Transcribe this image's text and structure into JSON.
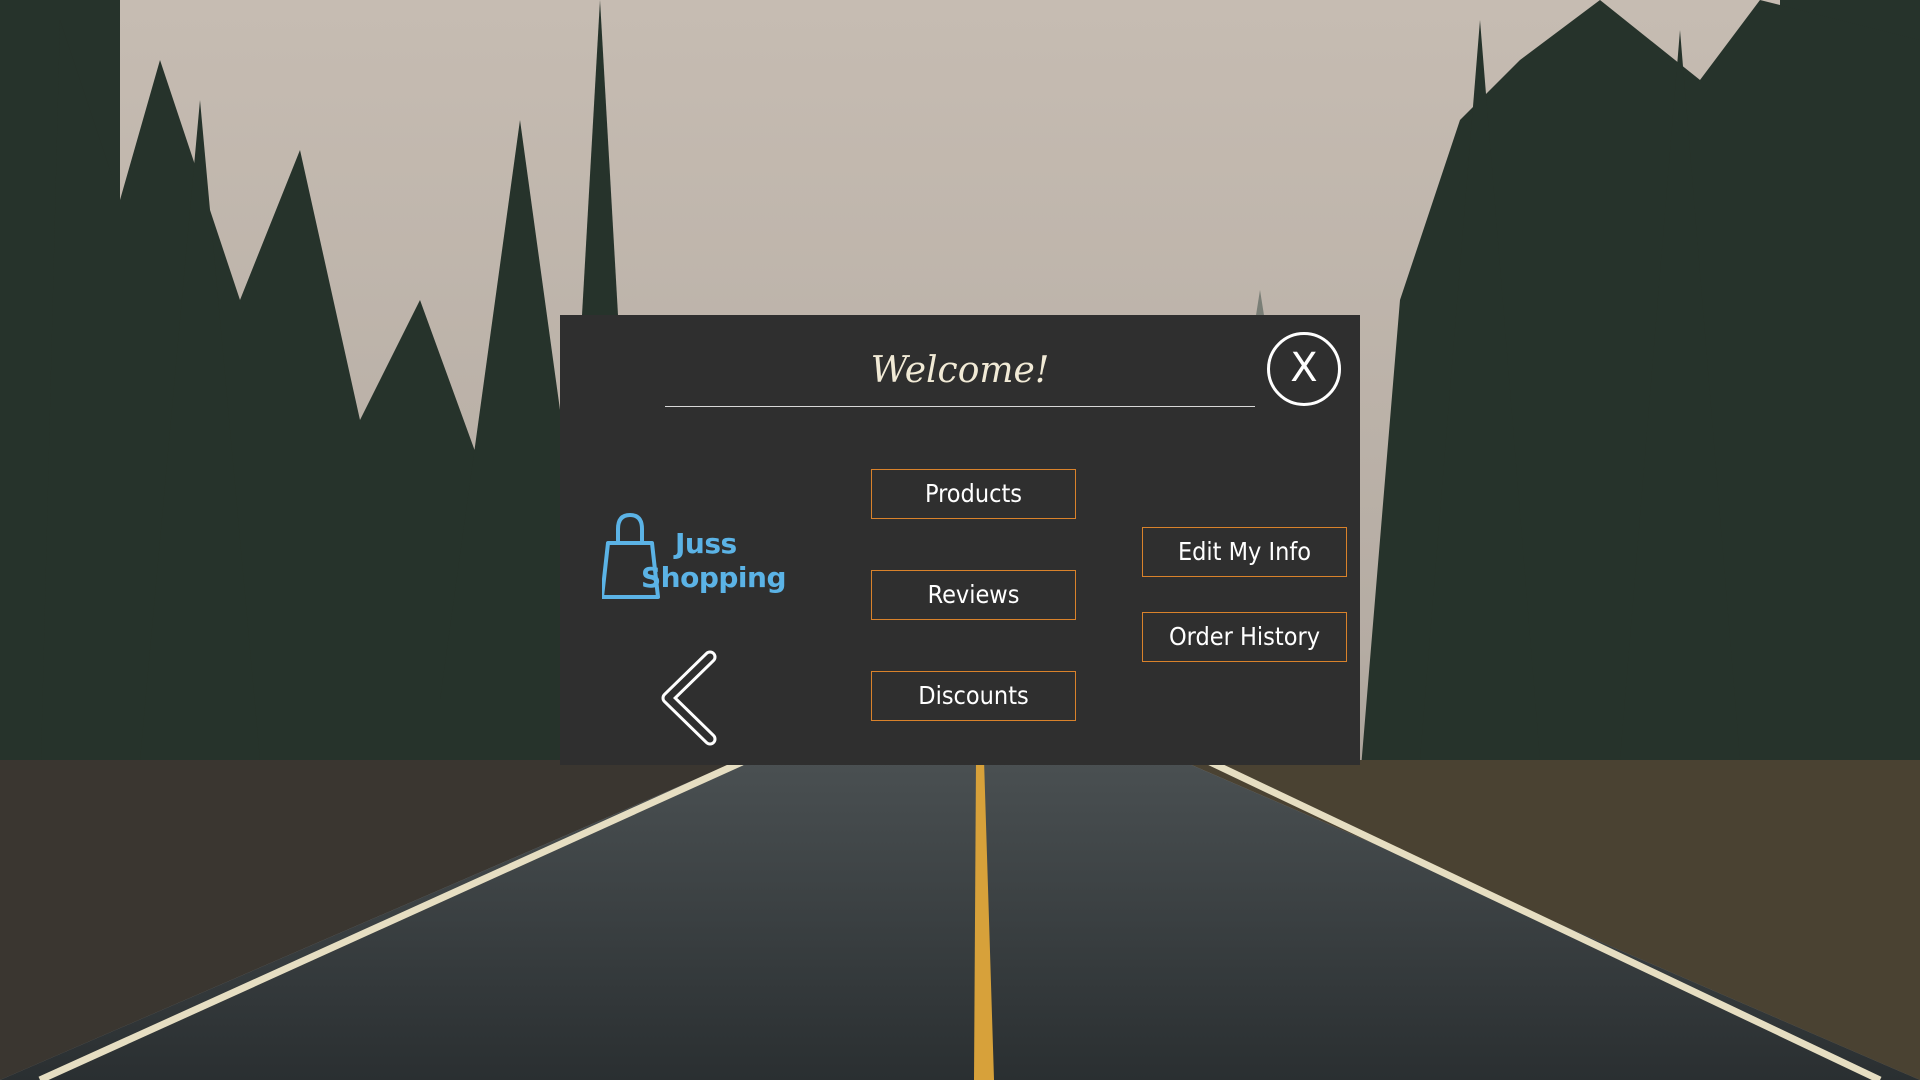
{
  "background": {
    "image": "forest-road-rain",
    "sky_color": "#b7aea5",
    "tree_color": "#2b3a30",
    "road_color": "#3b4144",
    "center_line_color": "#d7a13a",
    "edge_line_color": "#e8e1c7"
  },
  "dialog": {
    "title": "Welcome!",
    "close_label": "X",
    "background_color": "#2f2f2f",
    "accent_color": "#d9822b"
  },
  "logo": {
    "icon": "shopping-bag-icon",
    "line1": "Juss",
    "line2": "Shopping",
    "color": "#5bb3e6"
  },
  "back": {
    "icon": "chevron-left-icon"
  },
  "menu": {
    "products": "Products",
    "reviews": "Reviews",
    "discounts": "Discounts",
    "edit_info": "Edit My Info",
    "order_history": "Order History"
  }
}
